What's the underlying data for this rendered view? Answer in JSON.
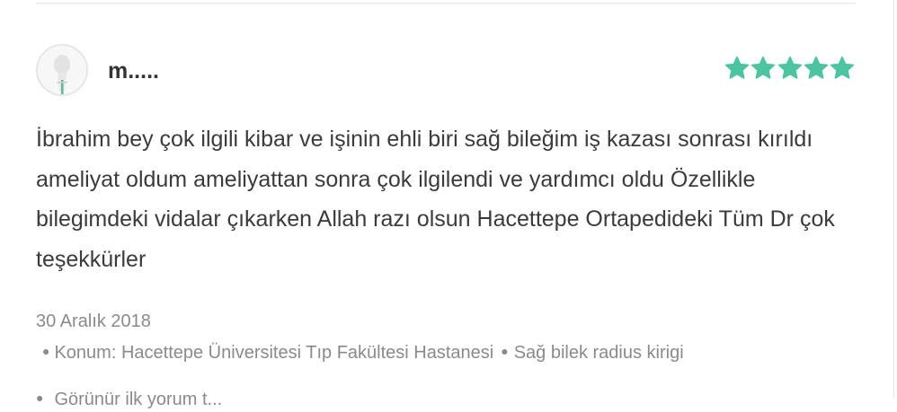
{
  "review": {
    "author_name": "m.....",
    "rating": 5,
    "rating_max": 5,
    "star_color": "#4cc4a1",
    "avatar_icon": "user-placeholder-icon",
    "text": "İbrahim bey çok ilgili kibar ve işinin ehli biri sağ bileğim iş kazası sonrası kırıldı ameliyat oldum ameliyattan sonra çok ilgilendi ve yardımcı oldu Özellikle bilegimdeki vidalar çıkarken Allah razı olsun Hacettepe Ortapedideki Tüm Dr çok teşekkürler",
    "date": "30 Aralık 2018",
    "location": "Konum: Hacettepe Üniversitesi Tıp Fakültesi Hastanesi",
    "condition": "Sağ bilek radius kirigi",
    "cutoff_text": "Görünür ilk yorum t..."
  }
}
